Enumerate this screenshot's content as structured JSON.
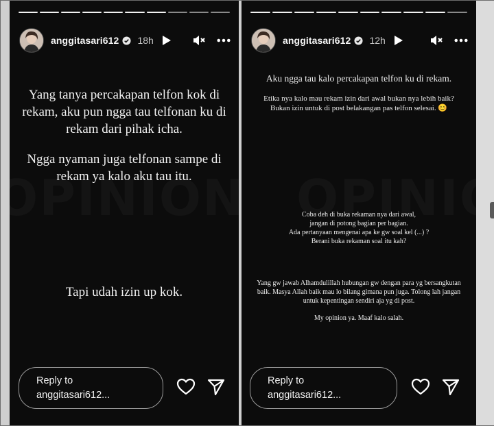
{
  "left_story": {
    "username": "anggitasari612",
    "time": "18h",
    "paragraph1": "Yang tanya percakapan telfon kok di rekam, aku pun ngga tau telfonan ku di rekam dari pihak icha.",
    "paragraph2": "Ngga nyaman juga telfonan sampe di rekam ya kalo aku tau itu.",
    "paragraph3": "Tapi udah izin up kok.",
    "reply_label": "Reply to",
    "reply_target": "anggitasari612..."
  },
  "right_story": {
    "username": "anggitasari612",
    "time": "12h",
    "paragraph1": "Aku ngga tau kalo percakapan telfon ku di rekam.",
    "paragraph2": "Etika nya kalo mau rekam izin dari awal bukan nya lebih baik? Bukan izin untuk di post belakangan pas telfon selesai. 😊",
    "paragraph3_lines": [
      "Coba deh di buka rekaman nya dari awal,",
      "jangan di potong bagian per bagian.",
      "Ada pertanyaan mengenai apa ke gw soal kel (...) ?",
      "Berani buka rekaman soal itu kah?"
    ],
    "paragraph4": "Yang gw jawab Alhamdulillah hubungan gw dengan para yg bersangkutan baik. Masya Allah baik mau lo bilang gimana pun juga. Tolong lah jangan untuk kepentingan sendiri aja yg di post.",
    "paragraph5": "My opinion ya. Maaf kalo salah.",
    "reply_label": "Reply to",
    "reply_target": "anggitasari612..."
  },
  "icons": {
    "verified": "verified-badge-icon",
    "play": "play-icon",
    "mute": "speaker-muted-icon",
    "more": "more-dots-icon",
    "like": "heart-icon",
    "share": "send-icon"
  },
  "colors": {
    "story_bg": "#0c0c0c",
    "text": "#f2f2f2",
    "progress_done": "#f2f2f2",
    "progress_pending": "#8a8a8a",
    "reply_border": "#9b9b9b"
  }
}
